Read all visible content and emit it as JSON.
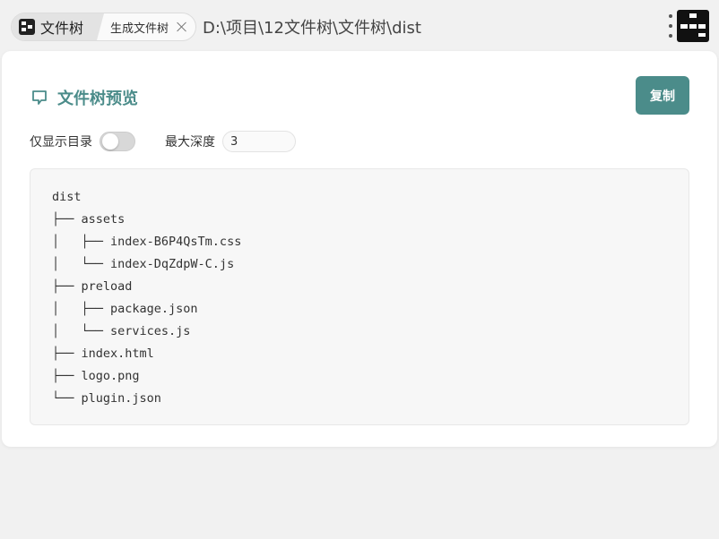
{
  "tabs": {
    "main_label": "文件树",
    "sub_label": "生成文件树"
  },
  "path": "D:\\项目\\12文件树\\文件树\\dist",
  "card": {
    "title": "文件树预览",
    "copy_label": "复制"
  },
  "options": {
    "dirs_only_label": "仅显示目录",
    "dirs_only_on": false,
    "max_depth_label": "最大深度",
    "max_depth_value": "3"
  },
  "tree_lines": [
    "dist",
    "├── assets",
    "│   ├── index-B6P4QsTm.css",
    "│   └── index-DqZdpW-C.js",
    "├── preload",
    "│   ├── package.json",
    "│   └── services.js",
    "├── index.html",
    "├── logo.png",
    "└── plugin.json"
  ],
  "colors": {
    "accent": "#4b8c8a",
    "background": "#f1f1f1"
  },
  "icons": {
    "title_icon": "chat-bubble-icon",
    "tab_icon": "file-tree-app-icon",
    "menu_icon": "kebab-menu-icon"
  }
}
